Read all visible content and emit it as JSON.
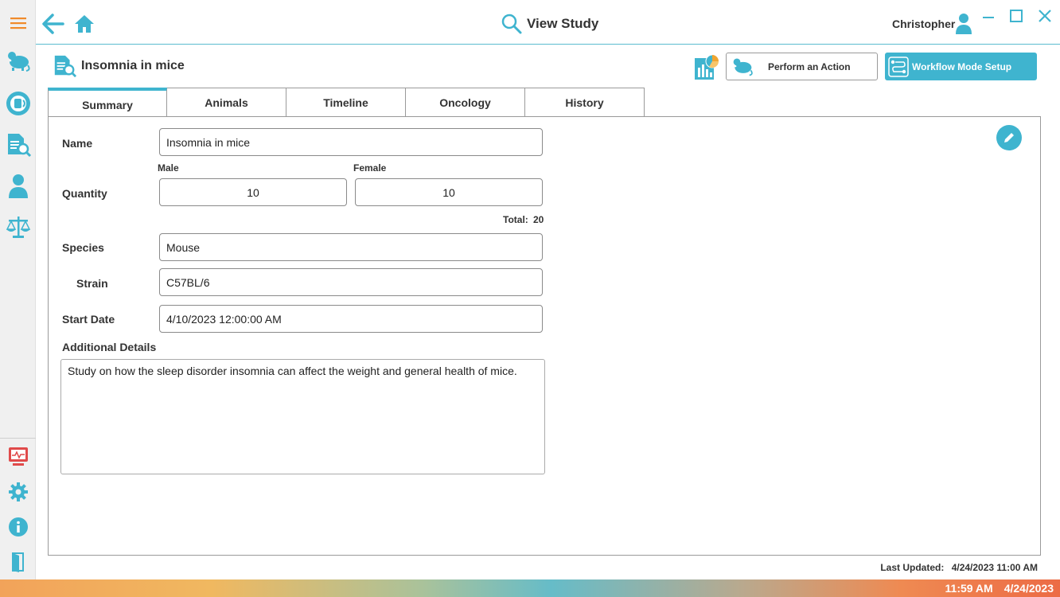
{
  "header": {
    "title": "View Study",
    "user_name": "Christopher"
  },
  "study": {
    "title": "Insomnia in mice",
    "perform_action_label": "Perform an Action",
    "workflow_label": "Workflow Mode Setup"
  },
  "tabs": [
    {
      "label": "Summary",
      "active": true
    },
    {
      "label": "Animals",
      "active": false
    },
    {
      "label": "Timeline",
      "active": false
    },
    {
      "label": "Oncology",
      "active": false
    },
    {
      "label": "History",
      "active": false
    }
  ],
  "form": {
    "name_label": "Name",
    "name_value": "Insomnia in mice",
    "quantity_label": "Quantity",
    "male_label": "Male",
    "female_label": "Female",
    "male_value": "10",
    "female_value": "10",
    "total_label": "Total:",
    "total_value": "20",
    "species_label": "Species",
    "species_value": "Mouse",
    "strain_label": "Strain",
    "strain_value": "C57BL/6",
    "start_date_label": "Start Date",
    "start_date_value": "4/10/2023 12:00:00 AM",
    "details_label": "Additional Details",
    "details_value": "Study on how the sleep disorder insomnia can affect the weight and general health of mice."
  },
  "footer": {
    "last_updated_label": "Last Updated:",
    "last_updated_value": "4/24/2023 11:00 AM"
  },
  "statusbar": {
    "time": "11:59 AM",
    "date": "4/24/2023"
  },
  "colors": {
    "accent": "#3fb4cf",
    "menu_icon": "#f08a2a",
    "monitor_icon": "#e04a4a"
  }
}
